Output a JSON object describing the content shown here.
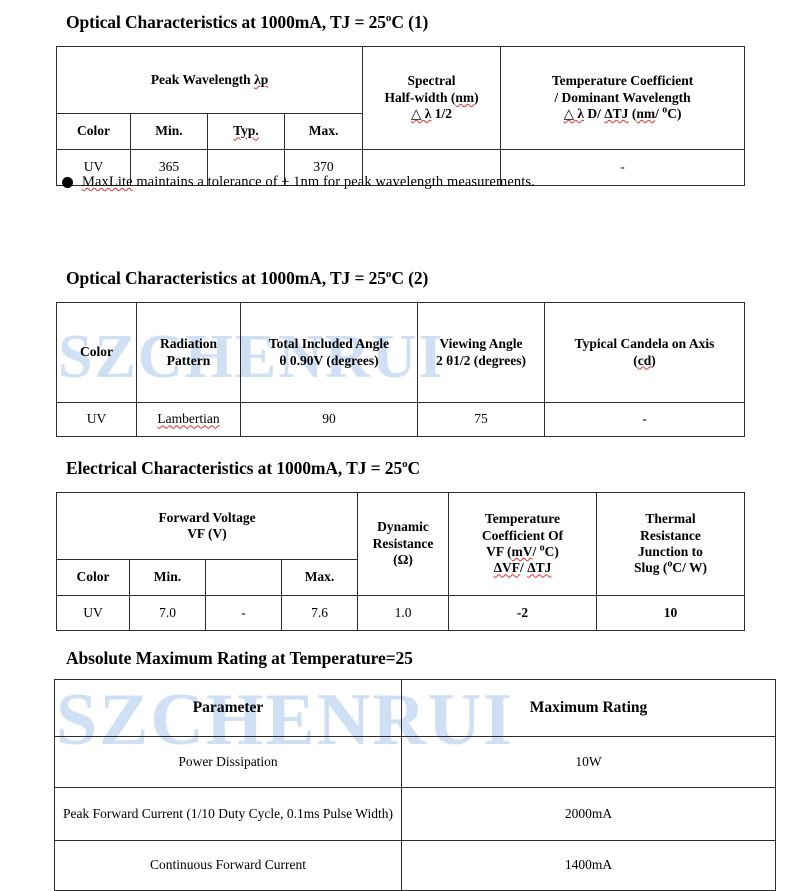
{
  "watermark": {
    "text": "SZCHENRUI"
  },
  "sections": {
    "optical1": {
      "title": "Optical Characteristics at 1000mA, TJ = 25",
      "title_deg": "o",
      "title_tail": "C (1)",
      "headers": {
        "peak_wavelength": "Peak Wavelength ",
        "peak_wavelength_symbol": "λp",
        "spectral_line1": "Spectral",
        "spectral_line2": "Half-width (nm)",
        "spectral_line3_a": "△ λ",
        "spectral_line3_b": " 1/2",
        "tempcoef_line1": "Temperature Coefficient",
        "tempcoef_line2": "/ Dominant Wavelength",
        "tempcoef_line3_a": "△ λ",
        "tempcoef_line3_b": " D/ ",
        "tempcoef_line3_c": "ΔTJ",
        "tempcoef_line3_d": " (",
        "tempcoef_line3_e": "nm",
        "tempcoef_line3_f": "/ ",
        "tempcoef_line3_g": "C)",
        "color": "Color",
        "min": "Min.",
        "typ": "Typ.",
        "max": "Max."
      },
      "row": {
        "color": "UV",
        "min": "365",
        "typ": "",
        "max": "370",
        "spectral": "",
        "tempcoef": "-"
      },
      "note": "MaxLite maintains a tolerance of  ±   1nm for peak wavelength measurements."
    },
    "optical2": {
      "title": "Optical Characteristics at 1000mA, TJ = 25",
      "title_deg": "o",
      "title_tail": "C (2)",
      "headers": {
        "color": "Color",
        "radiation_line1": "Radiation",
        "radiation_line2": "Pattern",
        "total_angle_line1": "Total Included Angle",
        "total_angle_line2": "θ 0.90V (degrees)",
        "viewing_angle_line1": "Viewing Angle",
        "viewing_angle_line2": "2 θ1/2 (degrees)",
        "candela_line1": "Typical Candela on Axis",
        "candela_line2": "(cd)"
      },
      "row": {
        "color": "UV",
        "radiation": "Lambertian",
        "total_angle": "90",
        "viewing_angle": "75",
        "candela": "-"
      }
    },
    "electrical": {
      "title": "Electrical Characteristics at 1000mA, TJ = 25",
      "title_deg": "o",
      "title_tail": "C",
      "headers": {
        "forward_voltage_line1": "Forward Voltage",
        "forward_voltage_line2": "VF (V)",
        "dynamic_line1": "Dynamic",
        "dynamic_line2": "Resistance",
        "dynamic_line3": "(Ω)",
        "tempcoef_line1": "Temperature",
        "tempcoef_line2": "Coefficient Of",
        "tempcoef_line3_a": "VF (",
        "tempcoef_line3_b": "mV",
        "tempcoef_line3_c": "/ ",
        "tempcoef_line3_d": "C)",
        "tempcoef_line4_a": "ΔVF",
        "tempcoef_line4_b": "/ ",
        "tempcoef_line4_c": "ΔTJ",
        "thermal_line1": "Thermal",
        "thermal_line2": "Resistance",
        "thermal_line3": "Junction to",
        "thermal_line4_a": "Slug (",
        "thermal_line4_b": "C/ W)",
        "color": "Color",
        "min": "Min.",
        "typ": "",
        "max": "Max."
      },
      "row": {
        "color": "UV",
        "min": "7.0",
        "typ": "-",
        "max": "7.6",
        "dynamic": "1.0",
        "tempcoef": "-2",
        "thermal": "10"
      }
    },
    "absmax": {
      "title": "Absolute Maximum Rating at Temperature=25",
      "headers": {
        "parameter": "Parameter",
        "maximum_rating": "Maximum Rating"
      },
      "rows": [
        {
          "parameter": "Power Dissipation",
          "rating": "10W"
        },
        {
          "parameter": "Peak Forward Current (1/10 Duty Cycle, 0.1ms Pulse Width)",
          "rating": "2000mA"
        },
        {
          "parameter": "Continuous Forward Current",
          "rating": "1400mA"
        }
      ]
    }
  }
}
